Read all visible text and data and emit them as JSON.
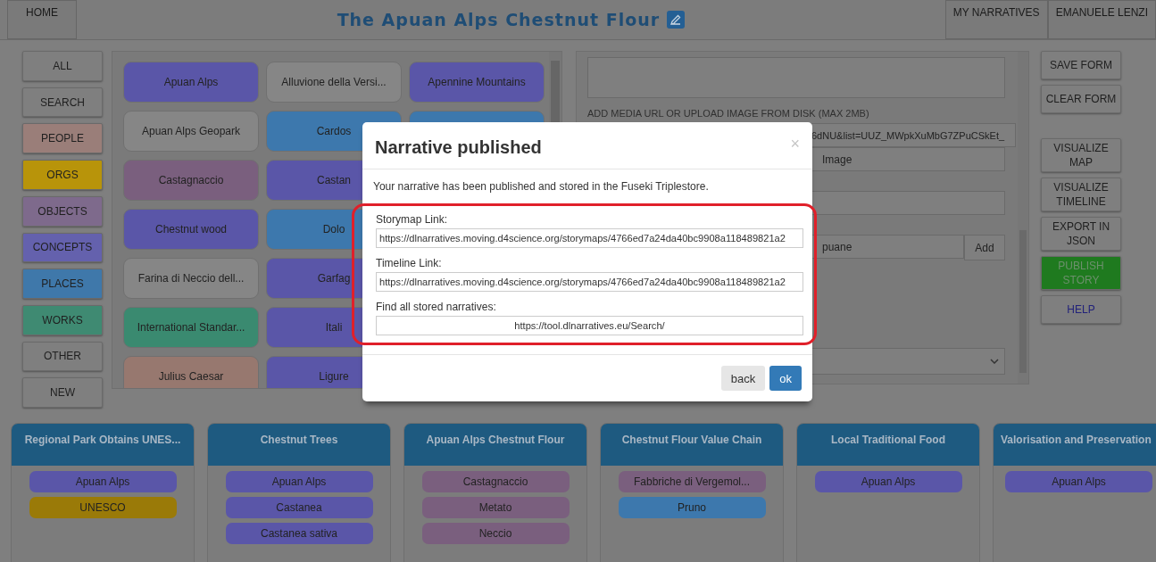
{
  "top_bar": {
    "home_button": "HOME",
    "title": "The Apuan Alps Chestnut Flour",
    "user_menu": [
      "MY NARRATIVES",
      "EMANUELE LENZI"
    ]
  },
  "filters": [
    {
      "label": "ALL",
      "color": "#7f7f7f"
    },
    {
      "label": "SEARCH",
      "color": "#7f7f7f"
    },
    {
      "label": "PEOPLE",
      "color": "#9a7e79"
    },
    {
      "label": "ORGS",
      "color": "#b8940a"
    },
    {
      "label": "OBJECTS",
      "color": "#7e6a8c"
    },
    {
      "label": "CONCEPTS",
      "color": "#6461ad"
    },
    {
      "label": "PLACES",
      "color": "#3f78aa"
    },
    {
      "label": "WORKS",
      "color": "#3f8a72"
    },
    {
      "label": "OTHER",
      "color": "#7f7f7f"
    },
    {
      "label": "NEW",
      "color": "#7f7f7f"
    }
  ],
  "entities": [
    [
      {
        "label": "Apuan Alps",
        "color": "#5a56a8"
      },
      {
        "label": "Alluvione della Versi...",
        "color": "#868686"
      },
      {
        "label": "Apennine Mountains",
        "color": "#5a56a8"
      }
    ],
    [
      {
        "label": "Apuan Alps Geopark",
        "color": "#868686"
      },
      {
        "label": "Cardos",
        "color": "#3d78ad"
      },
      {
        "color": "#3d78ad"
      }
    ],
    [
      {
        "label": "Castagnaccio",
        "color": "#7a5f7e"
      },
      {
        "label": "Castan",
        "color": "#5a56a8"
      }
    ],
    [
      {
        "label": "Chestnut wood",
        "color": "#5a56a8"
      },
      {
        "label": "Dolo",
        "color": "#3d78ad"
      }
    ],
    [
      {
        "label": "Farina di Neccio dell...",
        "color": "#868686"
      },
      {
        "label": "Garfag",
        "color": "#5a56a8"
      }
    ],
    [
      {
        "label": "International Standar...",
        "color": "#3a8a70"
      },
      {
        "label": "Itali",
        "color": "#5a56a8"
      }
    ],
    [
      {
        "label": "Julius Caesar",
        "color": "#97786f"
      },
      {
        "label": "Ligure",
        "color": "#5a56a8"
      }
    ]
  ],
  "form": {
    "media_label": "ADD MEDIA URL OR UPLOAD IMAGE FROM DISK (MAX 2MB)",
    "media_url": "6dNU&list=UUZ_MWpkXuMbG7ZPuCSkEt_",
    "media_type": "Image",
    "tag_value": "puane",
    "add_button": "Add"
  },
  "actions": [
    {
      "label": "SAVE FORM",
      "kind": "plain"
    },
    {
      "label": "CLEAR FORM",
      "kind": "plain"
    },
    {
      "label": "VISUALIZE MAP",
      "kind": "plain"
    },
    {
      "label": "VISUALIZE TIMELINE",
      "kind": "plain"
    },
    {
      "label": "EXPORT IN JSON",
      "kind": "plain"
    },
    {
      "label": "PUBLISH STORY",
      "kind": "publish"
    },
    {
      "label": "HELP",
      "kind": "help"
    }
  ],
  "modal": {
    "title": "Narrative published",
    "close": "×",
    "message": "Your narrative has been published and stored in the Fuseki Triplestore.",
    "links": [
      {
        "label": "Storymap Link:",
        "value": "https://dlnarratives.moving.d4science.org/storymaps/4766ed7a24da40bc9908a118489821a2",
        "centered": false
      },
      {
        "label": "Timeline Link:",
        "value": "https://dlnarratives.moving.d4science.org/storymaps/4766ed7a24da40bc9908a118489821a2",
        "centered": false
      },
      {
        "label": "Find all stored narratives:",
        "value": "https://tool.dlnarratives.eu/Search/",
        "centered": true
      }
    ],
    "buttons": [
      {
        "label": "back",
        "kind": "secondary"
      },
      {
        "label": "ok",
        "kind": "primary"
      }
    ]
  },
  "events": [
    {
      "title": "Regional Park Obtains UNES...",
      "entities": [
        {
          "label": "Apuan Alps",
          "color": "#5a56a8"
        },
        {
          "label": "UNESCO",
          "color": "#9a7a08"
        }
      ]
    },
    {
      "title": "Chestnut Trees",
      "entities": [
        {
          "label": "Apuan Alps",
          "color": "#5a56a8"
        },
        {
          "label": "Castanea",
          "color": "#5a56a8"
        },
        {
          "label": "Castanea sativa",
          "color": "#5a56a8"
        }
      ]
    },
    {
      "title": "Apuan Alps Chestnut Flour",
      "entities": [
        {
          "label": "Castagnaccio",
          "color": "#7a5f7e"
        },
        {
          "label": "Metato",
          "color": "#7a5f7e"
        },
        {
          "label": "Neccio",
          "color": "#7a5f7e"
        }
      ]
    },
    {
      "title": "Chestnut Flour Value Chain",
      "entities": [
        {
          "label": "Fabbriche di Vergemol...",
          "color": "#7a5f7e"
        },
        {
          "label": "Pruno",
          "color": "#3d78ad"
        }
      ]
    },
    {
      "title": "Local Traditional Food",
      "entities": [
        {
          "label": "Apuan Alps",
          "color": "#5a56a8"
        }
      ]
    },
    {
      "title": "Valorisation and Preservation",
      "entities": [
        {
          "label": "Apuan Alps",
          "color": "#5a56a8"
        }
      ]
    }
  ]
}
